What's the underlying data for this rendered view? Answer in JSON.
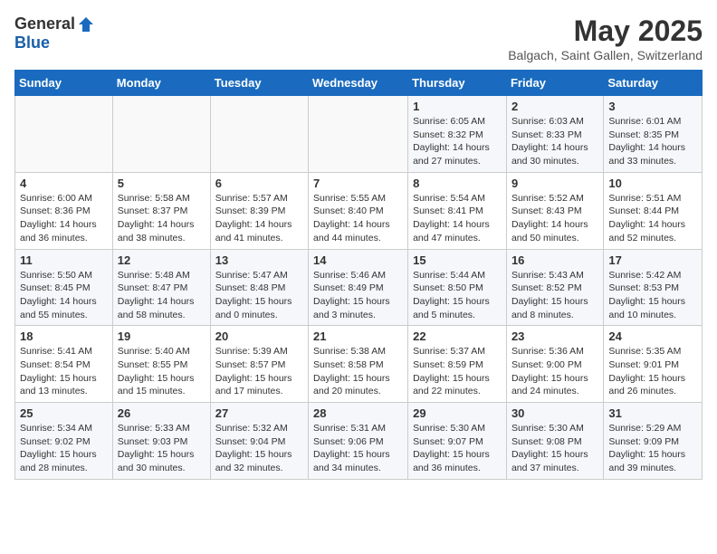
{
  "header": {
    "logo_general": "General",
    "logo_blue": "Blue",
    "month_title": "May 2025",
    "subtitle": "Balgach, Saint Gallen, Switzerland"
  },
  "weekdays": [
    "Sunday",
    "Monday",
    "Tuesday",
    "Wednesday",
    "Thursday",
    "Friday",
    "Saturday"
  ],
  "weeks": [
    [
      {
        "day": "",
        "info": ""
      },
      {
        "day": "",
        "info": ""
      },
      {
        "day": "",
        "info": ""
      },
      {
        "day": "",
        "info": ""
      },
      {
        "day": "1",
        "info": "Sunrise: 6:05 AM\nSunset: 8:32 PM\nDaylight: 14 hours\nand 27 minutes."
      },
      {
        "day": "2",
        "info": "Sunrise: 6:03 AM\nSunset: 8:33 PM\nDaylight: 14 hours\nand 30 minutes."
      },
      {
        "day": "3",
        "info": "Sunrise: 6:01 AM\nSunset: 8:35 PM\nDaylight: 14 hours\nand 33 minutes."
      }
    ],
    [
      {
        "day": "4",
        "info": "Sunrise: 6:00 AM\nSunset: 8:36 PM\nDaylight: 14 hours\nand 36 minutes."
      },
      {
        "day": "5",
        "info": "Sunrise: 5:58 AM\nSunset: 8:37 PM\nDaylight: 14 hours\nand 38 minutes."
      },
      {
        "day": "6",
        "info": "Sunrise: 5:57 AM\nSunset: 8:39 PM\nDaylight: 14 hours\nand 41 minutes."
      },
      {
        "day": "7",
        "info": "Sunrise: 5:55 AM\nSunset: 8:40 PM\nDaylight: 14 hours\nand 44 minutes."
      },
      {
        "day": "8",
        "info": "Sunrise: 5:54 AM\nSunset: 8:41 PM\nDaylight: 14 hours\nand 47 minutes."
      },
      {
        "day": "9",
        "info": "Sunrise: 5:52 AM\nSunset: 8:43 PM\nDaylight: 14 hours\nand 50 minutes."
      },
      {
        "day": "10",
        "info": "Sunrise: 5:51 AM\nSunset: 8:44 PM\nDaylight: 14 hours\nand 52 minutes."
      }
    ],
    [
      {
        "day": "11",
        "info": "Sunrise: 5:50 AM\nSunset: 8:45 PM\nDaylight: 14 hours\nand 55 minutes."
      },
      {
        "day": "12",
        "info": "Sunrise: 5:48 AM\nSunset: 8:47 PM\nDaylight: 14 hours\nand 58 minutes."
      },
      {
        "day": "13",
        "info": "Sunrise: 5:47 AM\nSunset: 8:48 PM\nDaylight: 15 hours\nand 0 minutes."
      },
      {
        "day": "14",
        "info": "Sunrise: 5:46 AM\nSunset: 8:49 PM\nDaylight: 15 hours\nand 3 minutes."
      },
      {
        "day": "15",
        "info": "Sunrise: 5:44 AM\nSunset: 8:50 PM\nDaylight: 15 hours\nand 5 minutes."
      },
      {
        "day": "16",
        "info": "Sunrise: 5:43 AM\nSunset: 8:52 PM\nDaylight: 15 hours\nand 8 minutes."
      },
      {
        "day": "17",
        "info": "Sunrise: 5:42 AM\nSunset: 8:53 PM\nDaylight: 15 hours\nand 10 minutes."
      }
    ],
    [
      {
        "day": "18",
        "info": "Sunrise: 5:41 AM\nSunset: 8:54 PM\nDaylight: 15 hours\nand 13 minutes."
      },
      {
        "day": "19",
        "info": "Sunrise: 5:40 AM\nSunset: 8:55 PM\nDaylight: 15 hours\nand 15 minutes."
      },
      {
        "day": "20",
        "info": "Sunrise: 5:39 AM\nSunset: 8:57 PM\nDaylight: 15 hours\nand 17 minutes."
      },
      {
        "day": "21",
        "info": "Sunrise: 5:38 AM\nSunset: 8:58 PM\nDaylight: 15 hours\nand 20 minutes."
      },
      {
        "day": "22",
        "info": "Sunrise: 5:37 AM\nSunset: 8:59 PM\nDaylight: 15 hours\nand 22 minutes."
      },
      {
        "day": "23",
        "info": "Sunrise: 5:36 AM\nSunset: 9:00 PM\nDaylight: 15 hours\nand 24 minutes."
      },
      {
        "day": "24",
        "info": "Sunrise: 5:35 AM\nSunset: 9:01 PM\nDaylight: 15 hours\nand 26 minutes."
      }
    ],
    [
      {
        "day": "25",
        "info": "Sunrise: 5:34 AM\nSunset: 9:02 PM\nDaylight: 15 hours\nand 28 minutes."
      },
      {
        "day": "26",
        "info": "Sunrise: 5:33 AM\nSunset: 9:03 PM\nDaylight: 15 hours\nand 30 minutes."
      },
      {
        "day": "27",
        "info": "Sunrise: 5:32 AM\nSunset: 9:04 PM\nDaylight: 15 hours\nand 32 minutes."
      },
      {
        "day": "28",
        "info": "Sunrise: 5:31 AM\nSunset: 9:06 PM\nDaylight: 15 hours\nand 34 minutes."
      },
      {
        "day": "29",
        "info": "Sunrise: 5:30 AM\nSunset: 9:07 PM\nDaylight: 15 hours\nand 36 minutes."
      },
      {
        "day": "30",
        "info": "Sunrise: 5:30 AM\nSunset: 9:08 PM\nDaylight: 15 hours\nand 37 minutes."
      },
      {
        "day": "31",
        "info": "Sunrise: 5:29 AM\nSunset: 9:09 PM\nDaylight: 15 hours\nand 39 minutes."
      }
    ]
  ]
}
